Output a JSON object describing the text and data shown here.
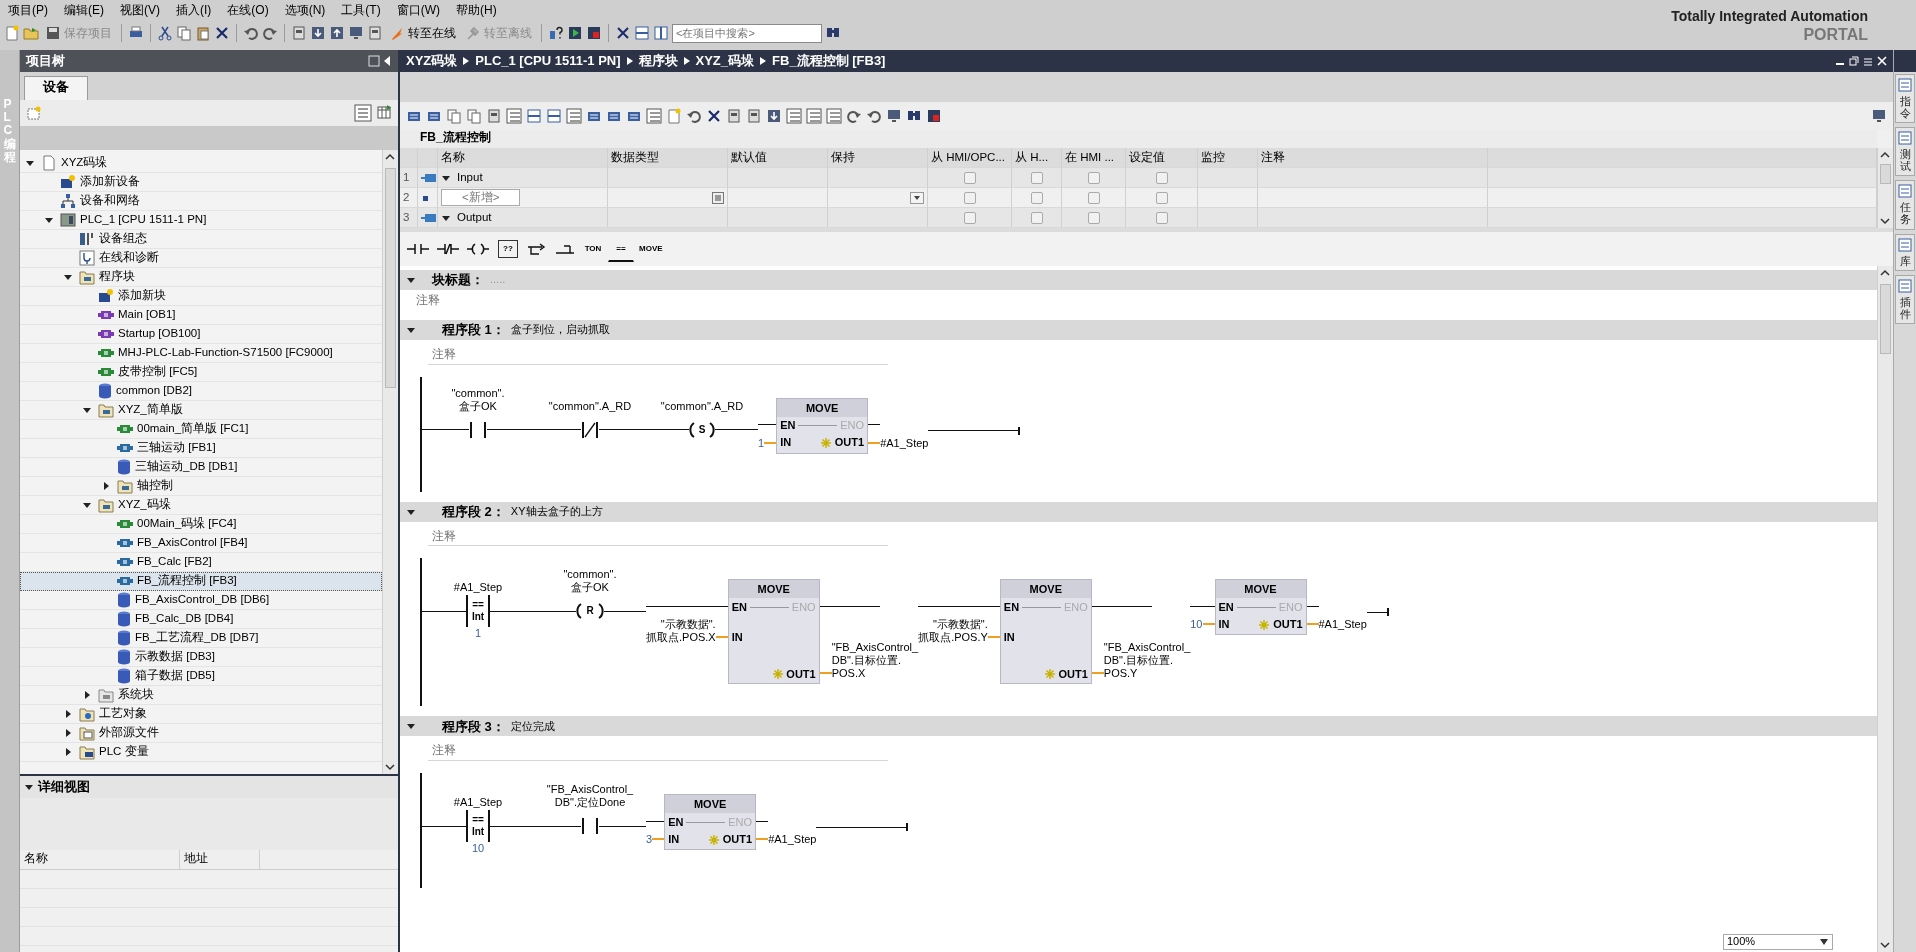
{
  "menu": [
    "项目(P)",
    "编辑(E)",
    "视图(V)",
    "插入(I)",
    "在线(O)",
    "选项(N)",
    "工具(T)",
    "窗口(W)",
    "帮助(H)"
  ],
  "toolbar": {
    "buttons": [
      {
        "kind": "save",
        "label": "保存项目",
        "disabled": true
      },
      {
        "kind": "online",
        "label": "转至在线",
        "disabled": false
      },
      {
        "kind": "offline",
        "label": "转至离线",
        "disabled": true
      }
    ],
    "search": {
      "placeholder": "<在项目中搜索>"
    }
  },
  "brand": {
    "line1": "Totally Integrated Automation",
    "line2": "PORTAL"
  },
  "left_strip": {
    "label": "PLC 编程"
  },
  "project_tree": {
    "title": "项目树",
    "tabs": [
      {
        "label": "设备",
        "selected": true
      }
    ],
    "items": [
      {
        "kind": "project",
        "label": "XYZ码垛",
        "expanded": true,
        "selected": false,
        "children": [
          {
            "kind": "add_device",
            "label": "添加新设备",
            "selected": false
          },
          {
            "kind": "network",
            "label": "设备和网络",
            "selected": false
          },
          {
            "kind": "plc",
            "label": "PLC_1 [CPU 1511-1 PN]",
            "expanded": true,
            "selected": false,
            "children": [
              {
                "kind": "config",
                "label": "设备组态",
                "selected": false
              },
              {
                "kind": "diag",
                "label": "在线和诊断",
                "selected": false
              },
              {
                "kind": "folder",
                "label": "程序块",
                "expanded": true,
                "selected": false,
                "children": [
                  {
                    "kind": "add_block",
                    "label": "添加新块",
                    "selected": false
                  },
                  {
                    "kind": "ob",
                    "label": "Main [OB1]",
                    "selected": false
                  },
                  {
                    "kind": "ob",
                    "label": "Startup [OB100]",
                    "selected": false
                  },
                  {
                    "kind": "fc",
                    "label": "MHJ-PLC-Lab-Function-S71500 [FC9000]",
                    "selected": false
                  },
                  {
                    "kind": "fc",
                    "label": "皮带控制 [FC5]",
                    "selected": false
                  },
                  {
                    "kind": "db",
                    "label": "common [DB2]",
                    "selected": false
                  },
                  {
                    "kind": "folder",
                    "label": "XYZ_简单版",
                    "expanded": true,
                    "selected": false,
                    "children": [
                      {
                        "kind": "fc",
                        "label": "00main_简单版 [FC1]",
                        "selected": false
                      },
                      {
                        "kind": "fb",
                        "label": "三轴运动 [FB1]",
                        "selected": false
                      },
                      {
                        "kind": "db",
                        "label": "三轴运动_DB [DB1]",
                        "selected": false
                      },
                      {
                        "kind": "folder",
                        "label": "轴控制",
                        "expanded": false,
                        "selected": false
                      }
                    ]
                  },
                  {
                    "kind": "folder",
                    "label": "XYZ_码垛",
                    "expanded": true,
                    "selected": false,
                    "children": [
                      {
                        "kind": "fc",
                        "label": "00Main_码垛 [FC4]",
                        "selected": false
                      },
                      {
                        "kind": "fb",
                        "label": "FB_AxisControl [FB4]",
                        "selected": false
                      },
                      {
                        "kind": "fb",
                        "label": "FB_Calc [FB2]",
                        "selected": false
                      },
                      {
                        "kind": "fb",
                        "label": "FB_流程控制 [FB3]",
                        "selected": true
                      },
                      {
                        "kind": "db",
                        "label": "FB_AxisControl_DB [DB6]",
                        "selected": false
                      },
                      {
                        "kind": "db",
                        "label": "FB_Calc_DB [DB4]",
                        "selected": false
                      },
                      {
                        "kind": "db",
                        "label": "FB_工艺流程_DB [DB7]",
                        "selected": false
                      },
                      {
                        "kind": "db",
                        "label": "示教数据 [DB3]",
                        "selected": false
                      },
                      {
                        "kind": "db",
                        "label": "箱子数据 [DB5]",
                        "selected": false
                      }
                    ]
                  },
                  {
                    "kind": "sys_folder",
                    "label": "系统块",
                    "expanded": false,
                    "selected": false
                  }
                ]
              },
              {
                "kind": "tech_folder",
                "label": "工艺对象",
                "expanded": false,
                "selected": false
              },
              {
                "kind": "src_folder",
                "label": "外部源文件",
                "expanded": false,
                "selected": false
              },
              {
                "kind": "tag_folder",
                "label": "PLC 变量",
                "expanded": false,
                "selected": false
              }
            ]
          }
        ]
      }
    ]
  },
  "detail_view": {
    "title": "详细视图",
    "columns": [
      "名称",
      "地址"
    ]
  },
  "editor": {
    "breadcrumb": [
      "XYZ码垛",
      "PLC_1 [CPU 1511-1 PN]",
      "程序块",
      "XYZ_码垛",
      "FB_流程控制 [FB3]"
    ],
    "interface": {
      "title": "FB_流程控制",
      "columns": [
        "名称",
        "数据类型",
        "默认值",
        "保持",
        "从 HMI/OPC...",
        "从 H...",
        "在 HMI ...",
        "设定值",
        "监控",
        "注释"
      ],
      "rows": [
        {
          "number": "1",
          "kind": "section",
          "name": "Input",
          "expanded": true,
          "flags": [
            {
              "checked": false
            },
            {
              "checked": false
            },
            {
              "checked": false
            },
            {
              "checked": false
            }
          ]
        },
        {
          "number": "2",
          "kind": "new",
          "name": "<新增>",
          "flags": [
            {
              "checked": false
            },
            {
              "checked": false
            },
            {
              "checked": false
            },
            {
              "checked": false
            }
          ]
        },
        {
          "number": "3",
          "kind": "section",
          "name": "Output",
          "expanded": true,
          "flags": [
            {
              "checked": false
            },
            {
              "checked": false
            },
            {
              "checked": false
            },
            {
              "checked": false
            }
          ]
        }
      ]
    },
    "favorites": [
      {
        "kind": "no_contact"
      },
      {
        "kind": "nc_contact"
      },
      {
        "kind": "coil"
      },
      {
        "kind": "box",
        "label": "??"
      },
      {
        "kind": "branch_open"
      },
      {
        "kind": "branch_close"
      },
      {
        "kind": "text",
        "label": "TON"
      },
      {
        "kind": "compare",
        "label": "=="
      },
      {
        "kind": "text",
        "label": "MOVE"
      }
    ],
    "block_title": {
      "label": "块标题：",
      "value": ".....",
      "comment": "注释",
      "expanded": true
    },
    "networks": [
      {
        "label": "程序段 1：",
        "title": "盒子到位，启动抓取",
        "comment": "注释",
        "expanded": true,
        "elements": [
          {
            "kind": "no_contact",
            "operand": [
              "\"common\".",
              "盒子OK"
            ]
          },
          {
            "kind": "nc_contact",
            "operand": [
              "\"common\".A_RD"
            ]
          },
          {
            "kind": "coil",
            "letter": "S",
            "operand": [
              "\"common\".A_RD"
            ]
          },
          {
            "kind": "move",
            "title": "MOVE",
            "en": "EN",
            "eno": "ENO",
            "in_pin": "IN",
            "out_pin": "OUT1",
            "in": [
              "1"
            ],
            "out": [
              "#A1_Step"
            ]
          }
        ]
      },
      {
        "label": "程序段 2：",
        "title": "XY轴去盒子的上方",
        "comment": "注释",
        "expanded": true,
        "elements": [
          {
            "kind": "compare",
            "operand": [
              "#A1_Step"
            ],
            "op": "==",
            "type": "Int",
            "value": "1"
          },
          {
            "kind": "coil",
            "letter": "R",
            "operand": [
              "\"common\".",
              "盒子OK"
            ]
          },
          {
            "kind": "move",
            "title": "MOVE",
            "en": "EN",
            "eno": "ENO",
            "in_pin": "IN",
            "out_pin": "OUT1",
            "in": [
              "\"示教数据\".",
              "抓取点.POS.X"
            ],
            "out": [
              "\"FB_AxisControl_",
              "DB\".目标位置.",
              "POS.X"
            ]
          },
          {
            "kind": "move",
            "title": "MOVE",
            "en": "EN",
            "eno": "ENO",
            "in_pin": "IN",
            "out_pin": "OUT1",
            "in": [
              "\"示教数据\".",
              "抓取点.POS.Y"
            ],
            "out": [
              "\"FB_AxisControl_",
              "DB\".目标位置.",
              "POS.Y"
            ]
          },
          {
            "kind": "move",
            "title": "MOVE",
            "en": "EN",
            "eno": "ENO",
            "in_pin": "IN",
            "out_pin": "OUT1",
            "in": [
              "10"
            ],
            "out": [
              "#A1_Step"
            ]
          }
        ]
      },
      {
        "label": "程序段 3：",
        "title": "定位完成",
        "comment": "注释",
        "expanded": true,
        "elements": [
          {
            "kind": "compare",
            "operand": [
              "#A1_Step"
            ],
            "op": "==",
            "type": "Int",
            "value": "10"
          },
          {
            "kind": "no_contact",
            "operand": [
              "\"FB_AxisControl_",
              "DB\".定位Done"
            ]
          },
          {
            "kind": "move",
            "title": "MOVE",
            "en": "EN",
            "eno": "ENO",
            "in_pin": "IN",
            "out_pin": "OUT1",
            "in": [
              "3"
            ],
            "out": [
              "#A1_Step"
            ]
          }
        ]
      }
    ],
    "zoom": {
      "value": "100%"
    }
  },
  "right_tabs": [
    {
      "label": "指令"
    },
    {
      "label": "测试"
    },
    {
      "label": "任务"
    },
    {
      "label": "库"
    },
    {
      "label": "插件"
    }
  ]
}
